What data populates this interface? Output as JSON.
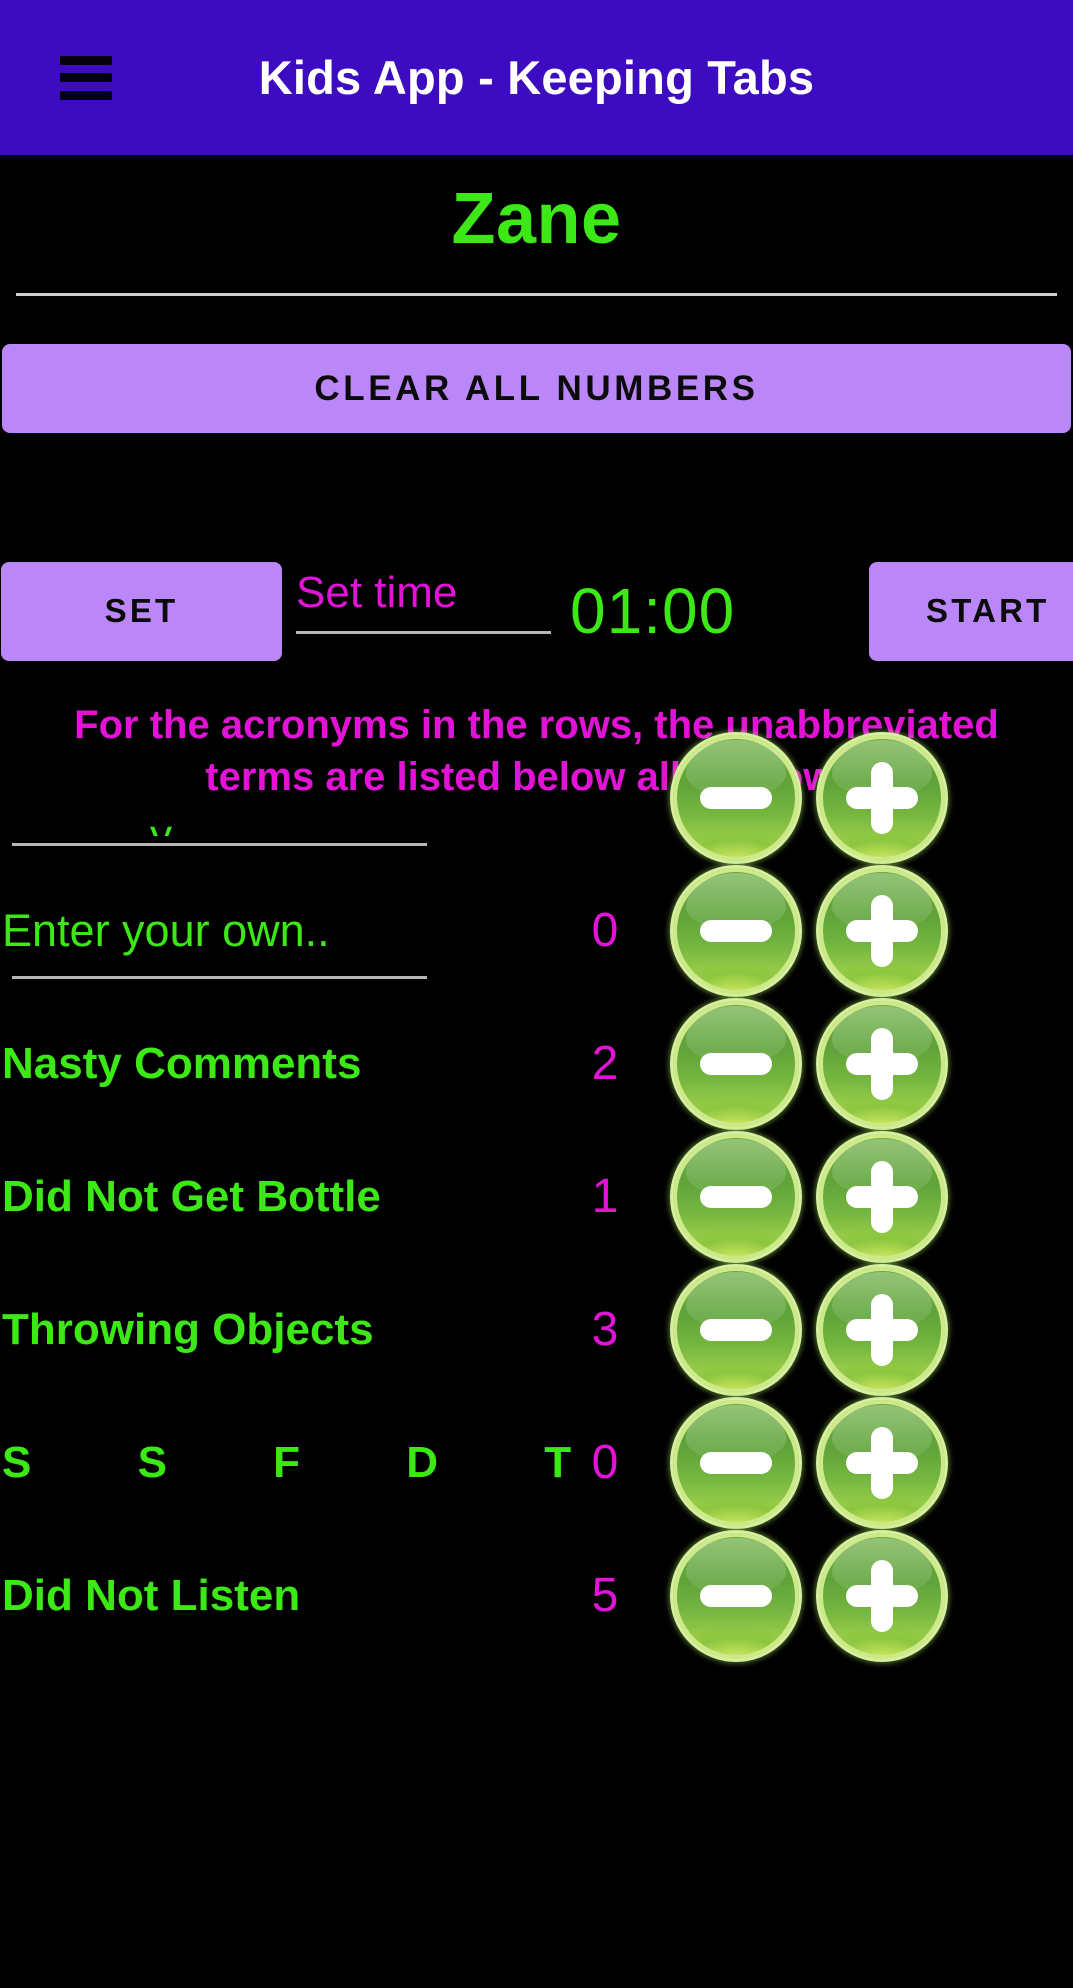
{
  "appbar": {
    "menu_icon": "hamburger-menu-icon",
    "title": "Kids App - Keeping Tabs",
    "bg_color": "#3d0bc0",
    "title_color": "#ffffff"
  },
  "name_field": {
    "value": "Zane",
    "color": "#3ce815"
  },
  "clear_button": {
    "label": "CLEAR ALL NUMBERS",
    "bg_color": "#bb86f8",
    "text_color": "#0b0b0b"
  },
  "timer": {
    "set_label": "SET",
    "set_time_placeholder": "Set time",
    "set_time_value": "",
    "display": "01:00",
    "start_label": "START",
    "placeholder_color": "#e213d6",
    "display_color": "#3ce815"
  },
  "note": {
    "text": "For the acronyms in the rows, the unabbreviated terms are listed below all the rows.",
    "color": "#e213d6"
  },
  "list": {
    "decrement_icon": "minus-icon",
    "increment_icon": "plus-icon",
    "label_color": "#3ce815",
    "count_color": "#e213d6",
    "rows": [
      {
        "label": "",
        "is_input": true,
        "placeholder": "",
        "count": "",
        "clipped": true
      },
      {
        "label": "Enter your own..",
        "is_input": true,
        "placeholder": "Enter your own..",
        "count": "0",
        "clipped": false
      },
      {
        "label": "Nasty Comments",
        "is_input": false,
        "count": "2",
        "clipped": false
      },
      {
        "label": "Did Not Get Bottle",
        "is_input": false,
        "count": "1",
        "clipped": false
      },
      {
        "label": "Throwing Objects",
        "is_input": false,
        "count": "3",
        "clipped": false
      },
      {
        "label": "S S F D T",
        "is_input": false,
        "is_acronym": true,
        "count": "0",
        "clipped": false
      },
      {
        "label": "Did Not Listen",
        "is_input": false,
        "count": "5",
        "clipped": false
      }
    ]
  }
}
